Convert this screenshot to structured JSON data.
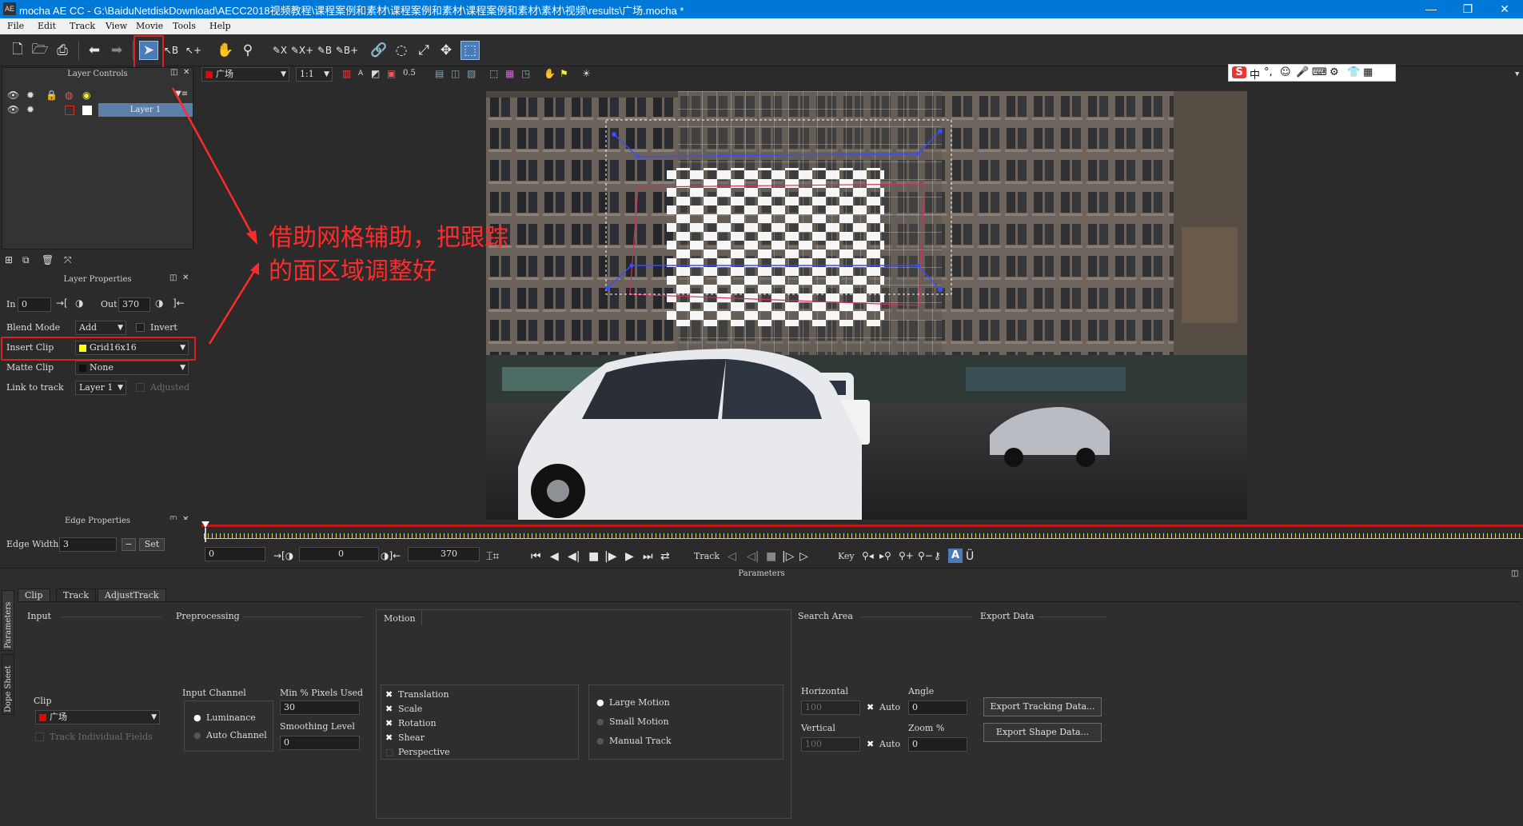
{
  "window": {
    "title": "mocha AE CC - G:\\BaiduNetdiskDownload\\AECC2018视频教程\\课程案例和素材\\课程案例和素材\\课程案例和素材\\素材\\视频\\results\\广场.mocha *",
    "logo": "AE",
    "minimize": "—",
    "maximize": "❐",
    "close": "✕"
  },
  "menu": [
    "File",
    "Edit",
    "Track",
    "View",
    "Movie",
    "Tools",
    "Help"
  ],
  "viewer_toolbar": {
    "clip": "广场",
    "zoom": "1:1",
    "opacity": "0.5"
  },
  "ime": {
    "logo": "S",
    "lang": "中",
    "punct": "°,"
  },
  "layer_controls": {
    "title": "Layer Controls",
    "layers": [
      {
        "name": "Layer 1"
      }
    ]
  },
  "layer_properties": {
    "title": "Layer Properties",
    "in_label": "In",
    "in_value": "0",
    "out_label": "Out",
    "out_value": "370",
    "blend_mode_label": "Blend Mode",
    "blend_mode_value": "Add",
    "invert_label": "Invert",
    "insert_clip_label": "Insert Clip",
    "insert_clip_value": "Grid16x16",
    "matte_clip_label": "Matte Clip",
    "matte_clip_value": "None",
    "link_to_track_label": "Link to track",
    "link_to_track_value": "Layer 1",
    "adjusted_label": "Adjusted"
  },
  "edge_properties": {
    "title": "Edge Properties",
    "edge_width_label": "Edge Width",
    "edge_width_value": "3",
    "minus": "−",
    "set": "Set",
    "plus": "+"
  },
  "timeline": {
    "in_frame": "0",
    "current_frame": "0",
    "out_frame": "370",
    "track_label": "Track",
    "key_label": "Key"
  },
  "params": {
    "title": "Parameters",
    "side_tabs": [
      "Parameters",
      "Dope Sheet"
    ],
    "tabs": [
      "Clip",
      "Track",
      "AdjustTrack"
    ],
    "input": {
      "title": "Input",
      "clip_label": "Clip",
      "clip_value": "广场",
      "track_individual_fields": "Track Individual Fields"
    },
    "preprocessing": {
      "title": "Preprocessing",
      "input_channel_label": "Input Channel",
      "luminance": "Luminance",
      "auto_channel": "Auto Channel",
      "min_pixels_label": "Min % Pixels Used",
      "min_pixels_value": "30",
      "smoothing_label": "Smoothing Level",
      "smoothing_value": "0"
    },
    "motion": {
      "title": "Motion",
      "options": [
        {
          "label": "Translation",
          "checked": true
        },
        {
          "label": "Scale",
          "checked": true
        },
        {
          "label": "Rotation",
          "checked": true
        },
        {
          "label": "Shear",
          "checked": true
        },
        {
          "label": "Perspective",
          "checked": false
        }
      ],
      "modes": [
        "Large Motion",
        "Small Motion",
        "Manual Track"
      ]
    },
    "search_area": {
      "title": "Search Area",
      "horizontal_label": "Horizontal",
      "horizontal_value": "100",
      "vertical_label": "Vertical",
      "vertical_value": "100",
      "auto_label": "Auto",
      "angle_label": "Angle",
      "angle_value": "0",
      "zoom_label": "Zoom %",
      "zoom_value": "0"
    },
    "export_data": {
      "title": "Export Data",
      "export_tracking": "Export Tracking Data...",
      "export_shape": "Export Shape Data..."
    }
  },
  "annotation": {
    "line1": "借助网格辅助，把跟踪",
    "line2": "的面区域调整好",
    "color": "#ff2a2a"
  }
}
